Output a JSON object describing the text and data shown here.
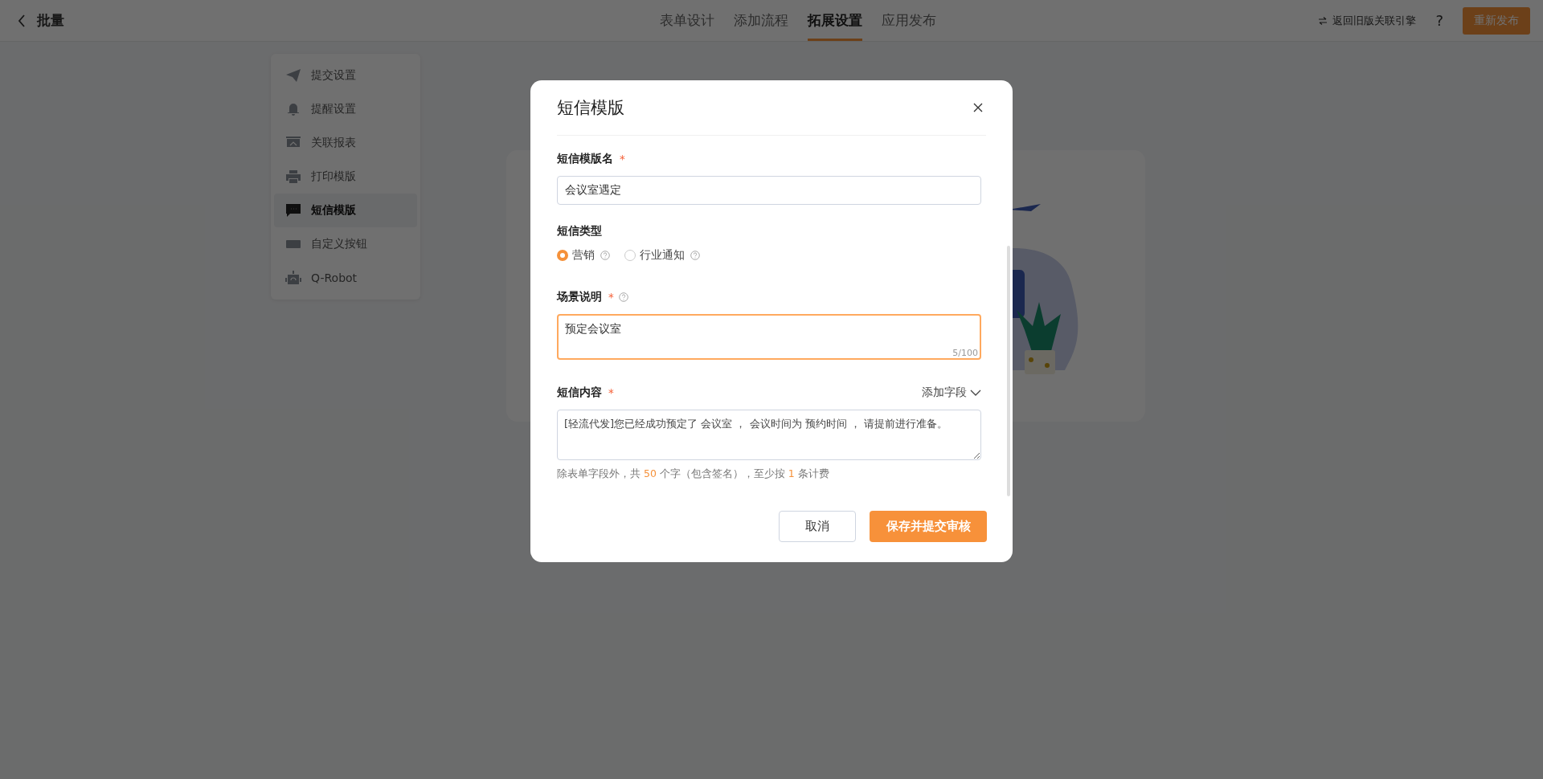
{
  "header": {
    "title": "批量",
    "legacy_link": "返回旧版关联引擎",
    "help": "?",
    "publish_button": "重新发布"
  },
  "nav_tabs": [
    {
      "label": "表单设计",
      "selected": false
    },
    {
      "label": "添加流程",
      "selected": false
    },
    {
      "label": "拓展设置",
      "selected": true
    },
    {
      "label": "应用发布",
      "selected": false
    }
  ],
  "sidebar": {
    "items": [
      {
        "kind": "send",
        "label": "提交设置",
        "selected": false
      },
      {
        "kind": "bell",
        "label": "提醒设置",
        "selected": false
      },
      {
        "kind": "report",
        "label": "关联报表",
        "selected": false
      },
      {
        "kind": "printer",
        "label": "打印模版",
        "selected": false
      },
      {
        "kind": "message",
        "label": "短信模版",
        "selected": true
      },
      {
        "kind": "button",
        "label": "自定义按钮",
        "selected": false
      },
      {
        "kind": "robot",
        "label": "Q-Robot",
        "selected": false
      }
    ]
  },
  "modal": {
    "title": "短信模版",
    "name_field": {
      "label": "短信模版名",
      "required_mark": "*",
      "value": "会议室遇定"
    },
    "type_field": {
      "label": "短信类型",
      "options": [
        {
          "label": "营销",
          "selected": true
        },
        {
          "label": "行业通知",
          "selected": false
        }
      ]
    },
    "scene_field": {
      "label": "场景说明",
      "required_mark": "*",
      "value": "预定会议室",
      "counter": "5/100",
      "focused": true
    },
    "content_field": {
      "label": "短信内容",
      "required_mark": "*",
      "add_field": "添加字段",
      "value": "[轻流代发]您已经成功预定了 会议室 ， 会议时间为 预约时间 ， 请提前进行准备。",
      "hint": {
        "before": "除表单字段外，共",
        "count": "50",
        "middle": "个字（包含签名），至少按",
        "messages": "1",
        "after": "条计费"
      }
    },
    "cancel_button": "取消",
    "submit_button": "保存并提交审核"
  }
}
